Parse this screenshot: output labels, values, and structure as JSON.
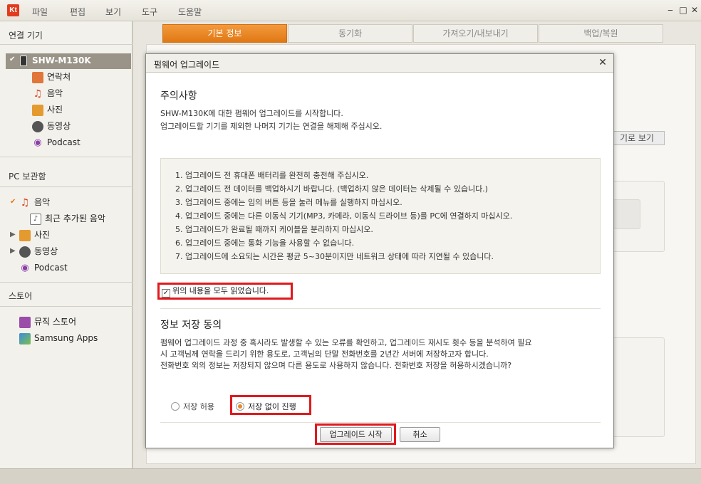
{
  "menubar": {
    "logo": "Kt",
    "items": [
      "파일",
      "편집",
      "보기",
      "도구",
      "도움말"
    ]
  },
  "sidebar": {
    "connected_title": "연결 기기",
    "device": "SHW-M130K",
    "device_items": [
      "연락처",
      "음악",
      "사진",
      "동영상",
      "Podcast"
    ],
    "pc_title": "PC 보관함",
    "pc_items": [
      "음악",
      "최근 추가된 음악",
      "사진",
      "동영상",
      "Podcast"
    ],
    "store_title": "스토어",
    "store_items": [
      "뮤직 스토어",
      "Samsung Apps"
    ]
  },
  "tabs": [
    "기본 정보",
    "동기화",
    "가져오기/내보내기",
    "백업/복원"
  ],
  "background": {
    "view_button": "기로 보기"
  },
  "dialog": {
    "title": "펌웨어 업그레이드",
    "section1_title": "주의사항",
    "intro_line1": "SHW-M130K에 대한 펌웨어 업그레이드를 시작합니다.",
    "intro_line2": "업그레이드할 기기를 제외한 나머지 기기는 연결을 해제해 주십시오.",
    "notices": [
      "1. 업그레이드 전 휴대폰 배터리를 완전히 충전해 주십시오.",
      "2. 업그레이드 전 데이터를 백업하시기 바랍니다. (백업하지 않은 데이터는 삭제될 수 있습니다.)",
      "3. 업그레이드 중에는 임의 버튼 등을 눌러 메뉴를 실행하지 마십시오.",
      "4. 업그레이드 중에는 다른 이동식 기기(MP3, 카메라, 이동식 드라이브 등)를 PC에 연결하지 마십시오.",
      "5. 업그레이드가 완료될 때까지 케이블을 분리하지 마십시오.",
      "6. 업그레이드 중에는 통화 기능을 사용할 수 없습니다.",
      "7. 업그레이드에 소요되는 시간은 평균 5~30분이지만 네트워크 상태에 따라 지연될 수 있습니다."
    ],
    "checkbox_label": "위의 내용을 모두 읽었습니다.",
    "checkbox_checked": true,
    "section2_title": "정보 저장 동의",
    "consent_line1": "펌웨어 업그레이드 과정 중 혹시라도 발생할 수 있는 오류를 확인하고, 업그레이드 재시도 횟수 등을 분석하여 필요",
    "consent_line2": "시 고객님께 연락을 드리기 위한 용도로, 고객님의 단말 전화번호를 2년간 서버에 저장하고자 합니다.",
    "consent_line3": "전화번호 외의 정보는 저장되지 않으며 다른 용도로 사용하지 않습니다. 전화번호 저장을 허용하시겠습니까?",
    "radio_allow": "저장 허용",
    "radio_deny": "저장 없이 진행",
    "selected_option": "저장 없이 진행",
    "start_button": "업그레이드 시작",
    "cancel_button": "취소"
  },
  "colors": {
    "accent_orange": "#e68a2a",
    "highlight_red": "#e0191c",
    "device_row": "#9a9488"
  }
}
